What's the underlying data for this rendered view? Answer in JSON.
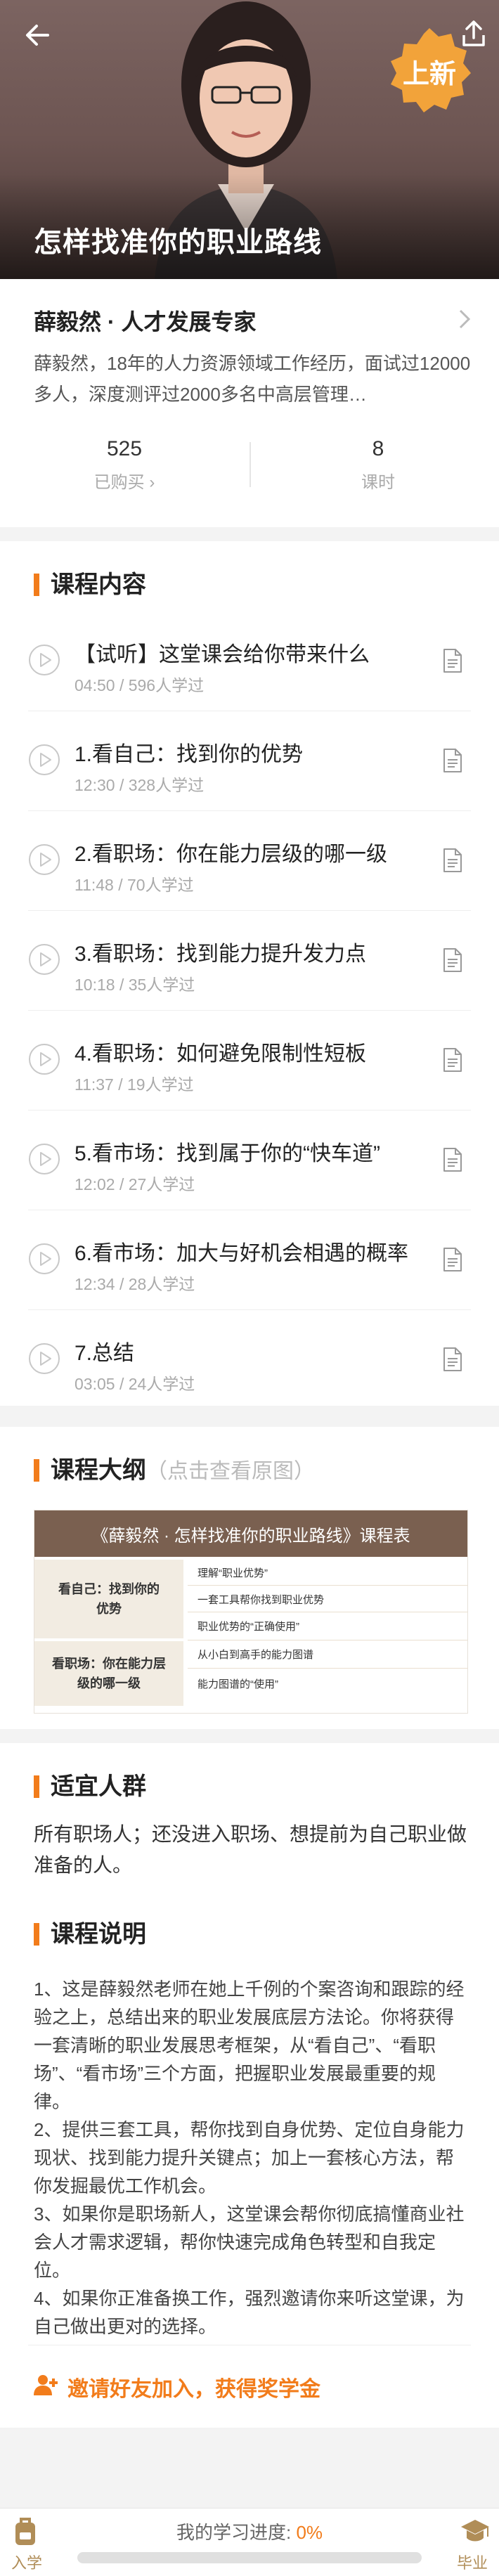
{
  "hero": {
    "title": "怎样找准你的职业路线",
    "badge": "上新",
    "back_icon": "arrow-left-icon",
    "share_icon": "share-icon"
  },
  "author": {
    "name": "薛毅然 · 人才发展专家",
    "bio": "薛毅然，18年的人力资源领域工作经历，面试过12000多人，深度测评过2000多名中高层管理…",
    "stats": [
      {
        "value": "525",
        "label": "已购买 ›"
      },
      {
        "value": "8",
        "label": "课时"
      }
    ]
  },
  "lessons_section": {
    "title": "课程内容",
    "items": [
      {
        "title": "【试听】这堂课会给你带来什么",
        "meta": "04:50 / 596人学过"
      },
      {
        "title": "1.看自己：找到你的优势",
        "meta": "12:30 / 328人学过"
      },
      {
        "title": "2.看职场：你在能力层级的哪一级",
        "meta": "11:48 / 70人学过"
      },
      {
        "title": "3.看职场：找到能力提升发力点",
        "meta": "10:18 / 35人学过"
      },
      {
        "title": "4.看职场：如何避免限制性短板",
        "meta": "11:37 / 19人学过"
      },
      {
        "title": "5.看市场：找到属于你的“快车道”",
        "meta": "12:02 / 27人学过"
      },
      {
        "title": "6.看市场：加大与好机会相遇的概率",
        "meta": "12:34 / 28人学过"
      },
      {
        "title": "7.总结",
        "meta": "03:05 / 24人学过"
      }
    ]
  },
  "outline_section": {
    "title": "课程大纲",
    "subtitle": "（点击查看原图）",
    "image": {
      "header": "《薛毅然 · 怎样找准你的职业路线》课程表",
      "left1": "看自己：找到你的优势",
      "left2": "看职场：你在能力层级的哪一级",
      "rows": [
        "理解“职业优势”",
        "一套工具帮你找到职业优势",
        "职业优势的“正确使用”",
        "从小白到高手的能力图谱",
        "能力图谱的“使用”"
      ]
    }
  },
  "suitable_section": {
    "title": "适宜人群",
    "text": "所有职场人；还没进入职场、想提前为自己职业做准备的人。"
  },
  "desc_section": {
    "title": "课程说明",
    "paragraphs": [
      "1、这是薛毅然老师在她上千例的个案咨询和跟踪的经验之上，总结出来的职业发展底层方法论。你将获得一套清晰的职业发展思考框架，从“看自己”、“看职场”、“看市场”三个方面，把握职业发展最重要的规律。",
      "2、提供三套工具，帮你找到自身优势、定位自身能力现状、找到能力提升关键点；加上一套核心方法，帮你发掘最优工作机会。",
      "3、如果你是职场新人，这堂课会帮你彻底搞懂商业社会人才需求逻辑，帮你快速完成角色转型和自我定位。",
      "4、如果你正准备换工作，强烈邀请你来听这堂课，为自己做出更对的选择。"
    ]
  },
  "invite": {
    "text": "邀请好友加入，获得奖学金",
    "icon": "add-user-icon"
  },
  "bottom_bar": {
    "left_label": "入学",
    "right_label": "毕业",
    "progress_label": "我的学习进度: ",
    "progress_value": "0%",
    "progress_fraction": 0.0
  },
  "colors": {
    "accent": "#f27c1b",
    "gold": "#b08d57"
  }
}
